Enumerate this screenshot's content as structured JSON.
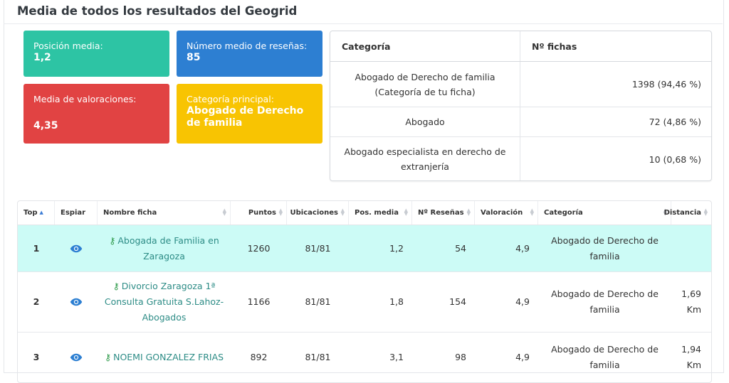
{
  "page_title": "Media de todos los resultados del Geogrid",
  "cards": {
    "avg_position": {
      "label": "Posición media:",
      "value": "1,2"
    },
    "avg_reviews": {
      "label": "Número medio de reseñas:",
      "value": "85"
    },
    "avg_rating": {
      "label": "Media de valoraciones:",
      "value": "4,35"
    },
    "main_category": {
      "label": "Categoría principal:",
      "value": "Abogado de Derecho de familia"
    }
  },
  "category_table": {
    "headers": [
      "Categoría",
      "Nº fichas"
    ],
    "rows": [
      {
        "category": "Abogado de Derecho de familia (Categoría de tu ficha)",
        "count": "1398 (94,46 %)"
      },
      {
        "category": "Abogado",
        "count": "72 (4,86 %)"
      },
      {
        "category": "Abogado especialista en derecho de extranjería",
        "count": "10 (0,68 %)"
      }
    ]
  },
  "results_table": {
    "headers": {
      "top": "Top",
      "espiar": "Espiar",
      "nombre": "Nombre ficha",
      "puntos": "Puntos",
      "ubicaciones": "Ubicaciones",
      "pos_media": "Pos. media",
      "resenas": "Nº Reseñas",
      "valoracion": "Valoración",
      "categoria": "Categoría",
      "distancia": "Distancia"
    },
    "rows": [
      {
        "top": "1",
        "name": "Abogada de Familia en Zaragoza",
        "points": "1260",
        "locations": "81/81",
        "avg_pos": "1,2",
        "reviews": "54",
        "rating": "4,9",
        "category": "Abogado de Derecho de familia",
        "distance": ""
      },
      {
        "top": "2",
        "name": "Divorcio Zaragoza 1ª Consulta Gratuita S.Lahoz-Abogados",
        "points": "1166",
        "locations": "81/81",
        "avg_pos": "1,8",
        "reviews": "154",
        "rating": "4,9",
        "category": "Abogado de Derecho de familia",
        "distance": "1,69 Km"
      },
      {
        "top": "3",
        "name": "NOEMI GONZALEZ FRIAS",
        "points": "892",
        "locations": "81/81",
        "avg_pos": "3,1",
        "reviews": "98",
        "rating": "4,9",
        "category": "Abogado de Derecho de familia",
        "distance": "1,94 Km"
      }
    ]
  },
  "icons": {
    "spy": "eye-icon",
    "owner": "key-icon"
  },
  "colors": {
    "teal": "#2dc4a4",
    "blue": "#2d7fd2",
    "red": "#e14343",
    "yellow": "#f8c402",
    "highlight_row": "#ccfbf6",
    "link": "#2d8c86",
    "eye": "#2d7fd2",
    "key": "#2e9a4a"
  }
}
